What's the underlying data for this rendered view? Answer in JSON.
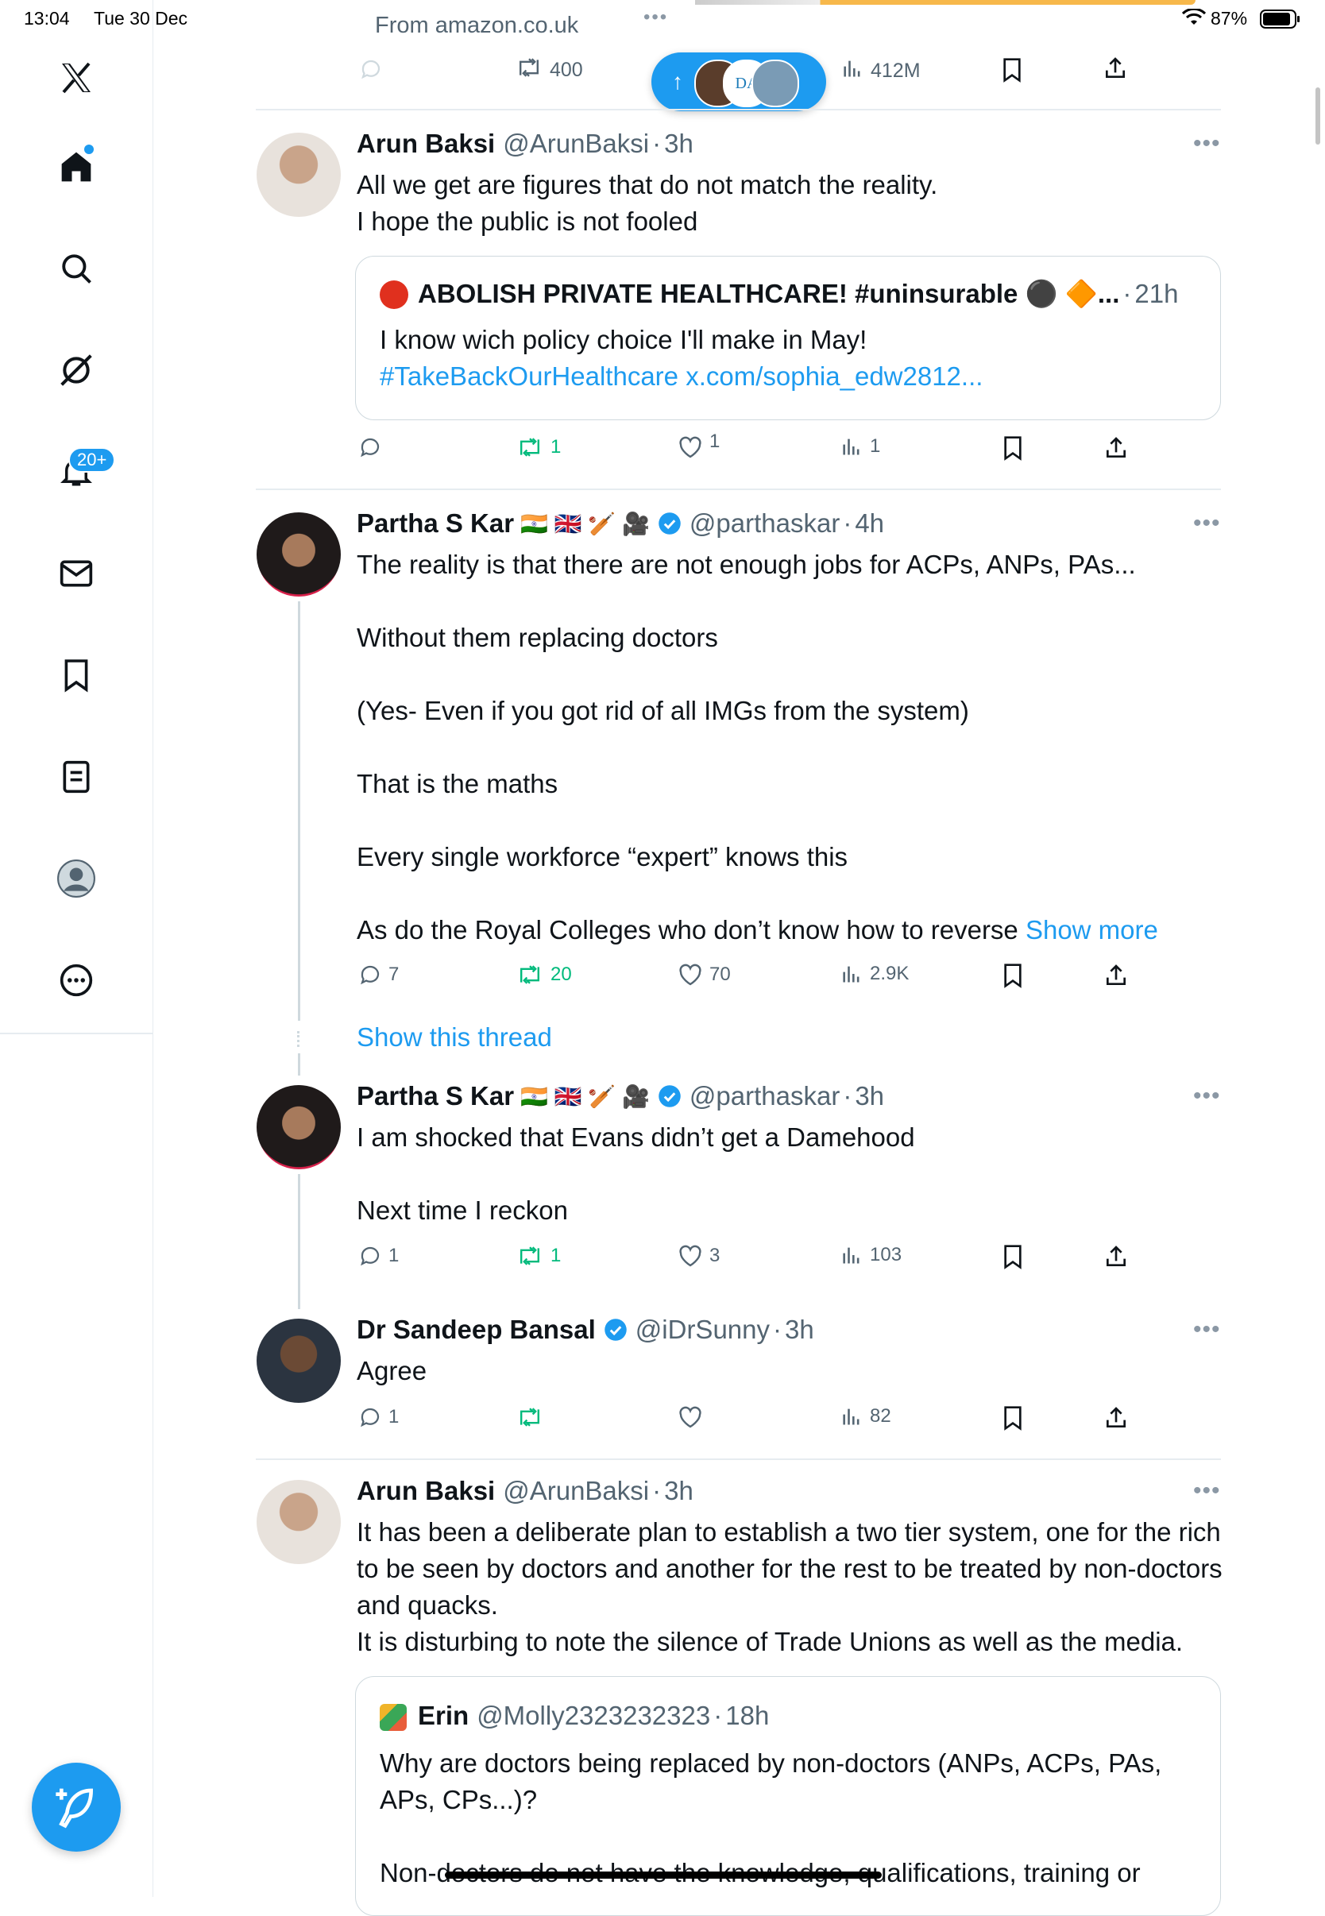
{
  "status_bar": {
    "time": "13:04",
    "date": "Tue 30 Dec",
    "battery": "87%"
  },
  "top_bar": {
    "source": "From amazon.co.uk",
    "ellipsis": "•••"
  },
  "top_actions": {
    "retweets": "400",
    "views": "412M"
  },
  "sidebar": {
    "notifications_badge": "20+",
    "items": [
      "x-logo",
      "home",
      "search",
      "grok",
      "notifications",
      "messages",
      "bookmarks",
      "lists",
      "profile",
      "more"
    ]
  },
  "new_posts_pill": {
    "arrow": "↑"
  },
  "tweets": [
    {
      "name": "Arun Baksi",
      "handle": "@ArunBaksi",
      "sep": "·",
      "time": "3h",
      "text": "All we get are figures that do not match the reality.\nI hope the public is not fooled",
      "quote": {
        "name": "ABOLISH PRIVATE HEALTHCARE! #uninsurable ⚫ 🔶...",
        "sep": "·",
        "time": "21h",
        "text": "I know wich policy choice I'll make in May!",
        "link": "#TakeBackOurHealthcare x.com/sophia_edw2812..."
      },
      "actions": {
        "replies": "",
        "retweets": "1",
        "likes": "1",
        "views": "1"
      }
    },
    {
      "name": "Partha S Kar",
      "flags": "🇮🇳 🇬🇧 🏏 🎥",
      "handle": "@parthaskar",
      "sep": "·",
      "time": "4h",
      "text": "The reality is that there are not enough jobs for ACPs, ANPs, PAs...\n\nWithout them replacing doctors\n\n(Yes- Even if you got rid of all IMGs from the system)\n\nThat is the maths\n\nEvery single workforce “expert” knows this\n\nAs do the Royal Colleges who don’t know how to reverse",
      "show_more": "Show more",
      "actions": {
        "replies": "7",
        "retweets": "20",
        "likes": "70",
        "views": "2.9K"
      }
    },
    {
      "show_thread": "Show this thread"
    },
    {
      "name": "Partha S Kar",
      "flags": "🇮🇳 🇬🇧 🏏 🎥",
      "handle": "@parthaskar",
      "sep": "·",
      "time": "3h",
      "text": "I am shocked that Evans didn’t get a Damehood\n\nNext time I reckon",
      "actions": {
        "replies": "1",
        "retweets": "1",
        "likes": "3",
        "views": "103"
      }
    },
    {
      "name": "Dr Sandeep Bansal",
      "handle": "@iDrSunny",
      "sep": "·",
      "time": "3h",
      "text": "Agree",
      "actions": {
        "replies": "1",
        "retweets": "",
        "likes": "",
        "views": "82"
      }
    },
    {
      "name": "Arun Baksi",
      "handle": "@ArunBaksi",
      "sep": "·",
      "time": "3h",
      "text": "It has been a deliberate plan to establish a two tier system, one for the rich to be seen by doctors and another for the rest to be treated by non-doctors and quacks.\nIt is disturbing to note the silence of Trade Unions as well as the media.",
      "quote": {
        "name": "Erin",
        "handle": "@Molly2323232323",
        "sep": "·",
        "time": "18h",
        "text": "Why are doctors being replaced by non-doctors (ANPs, ACPs, PAs, APs, CPs...)?\n\nNon-doctors do not have the knowledge, qualifications, training or"
      }
    }
  ],
  "more_label": "•••",
  "colors": {
    "accent": "#1d9bf0",
    "green": "#00ba7c",
    "muted": "#536471",
    "border": "#cfd9de"
  }
}
